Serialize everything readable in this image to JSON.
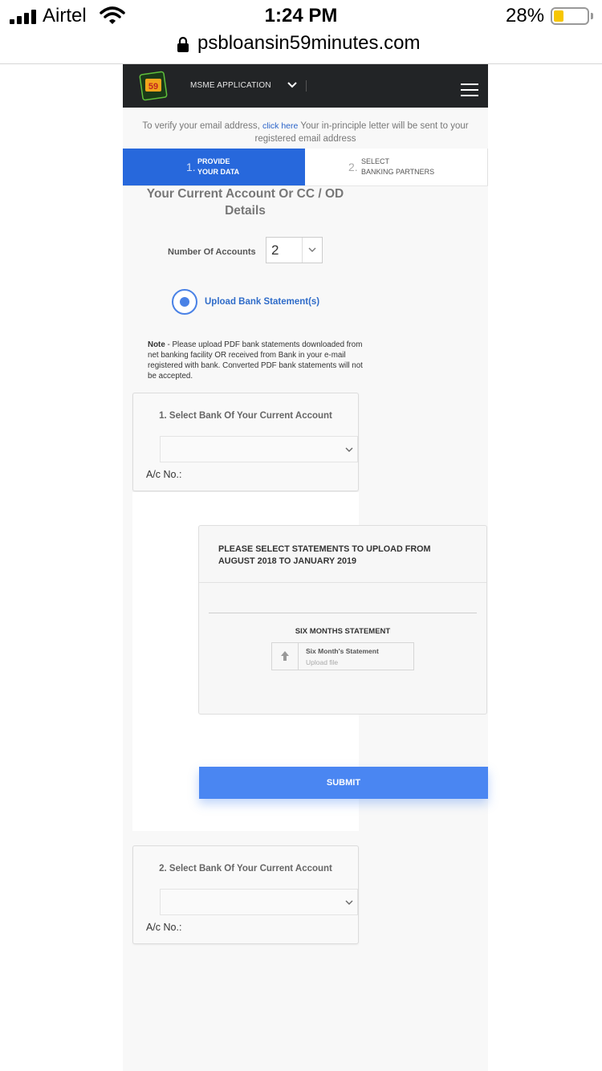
{
  "status_bar": {
    "carrier": "Airtel",
    "time": "1:24 PM",
    "battery_percent": "28%",
    "battery_level": 0.28
  },
  "browser": {
    "url": "psbloansin59minutes.com"
  },
  "navbar": {
    "logo_text": "59",
    "title": "MSME APPLICATION"
  },
  "verify": {
    "prefix": "To verify your email address,",
    "link": "click here",
    "suffix": "Your in-principle letter will be sent to your registered email address"
  },
  "steps": [
    {
      "number": "1.",
      "line1": "PROVIDE",
      "line2": "YOUR DATA",
      "active": true
    },
    {
      "number": "2.",
      "line1": "SELECT",
      "line2": "BANKING PARTNERS",
      "active": false
    }
  ],
  "section": {
    "title_line1": "Your Current Account Or CC / OD",
    "title_line2": "Details"
  },
  "accounts": {
    "label": "Number Of Accounts",
    "value": "2"
  },
  "upload_option": {
    "label": "Upload Bank Statement(s)",
    "selected": true
  },
  "note": {
    "label": "Note",
    "text": " - Please upload PDF bank statements downloaded from net banking facility OR received from Bank in your e-mail registered with bank. Converted PDF bank statements will not be accepted."
  },
  "bank_cards": [
    {
      "title": "1. Select Bank Of Your Current Account",
      "selected_bank": "",
      "acno_label": "A/c No.:"
    },
    {
      "title": "2. Select Bank Of Your Current Account",
      "selected_bank": "",
      "acno_label": "A/c No.:"
    }
  ],
  "upload_panel": {
    "heading": "PLEASE SELECT STATEMENTS TO UPLOAD FROM AUGUST 2018 TO JANUARY 2019",
    "subheading": "SIX MONTHS STATEMENT",
    "file_name": "Six Month's Statement",
    "file_hint": "Upload file"
  },
  "submit_label": "SUBMIT",
  "colors": {
    "primary": "#2768dc",
    "button": "#4a86f2",
    "navbar": "#222426",
    "link": "#2a63c9",
    "battery": "#f7c600"
  }
}
